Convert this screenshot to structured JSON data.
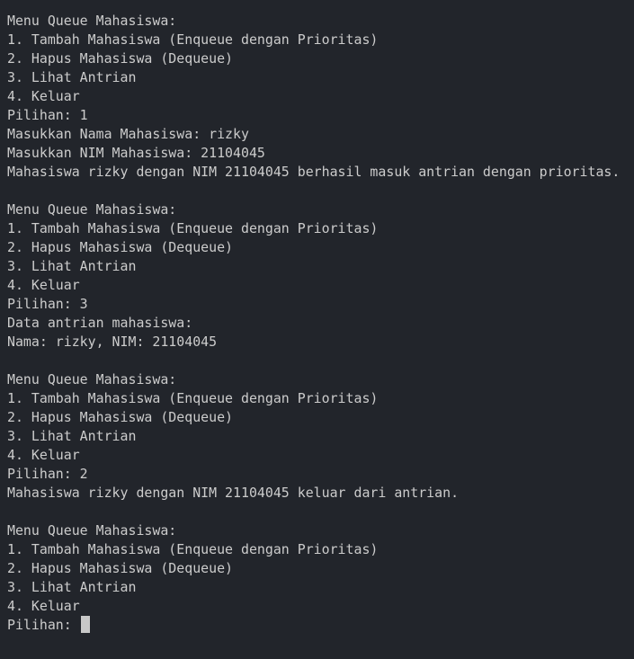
{
  "terminal": {
    "blocks": [
      {
        "menu_title": "Menu Queue Mahasiswa:",
        "options": [
          "1. Tambah Mahasiswa (Enqueue dengan Prioritas)",
          "2. Hapus Mahasiswa (Dequeue)",
          "3. Lihat Antrian",
          "4. Keluar"
        ],
        "choice": "Pilihan: 1",
        "output": [
          "Masukkan Nama Mahasiswa: rizky",
          "Masukkan NIM Mahasiswa: 21104045",
          "Mahasiswa rizky dengan NIM 21104045 berhasil masuk antrian dengan prioritas."
        ]
      },
      {
        "menu_title": "Menu Queue Mahasiswa:",
        "options": [
          "1. Tambah Mahasiswa (Enqueue dengan Prioritas)",
          "2. Hapus Mahasiswa (Dequeue)",
          "3. Lihat Antrian",
          "4. Keluar"
        ],
        "choice": "Pilihan: 3",
        "output": [
          "Data antrian mahasiswa:",
          "Nama: rizky, NIM: 21104045"
        ]
      },
      {
        "menu_title": "Menu Queue Mahasiswa:",
        "options": [
          "1. Tambah Mahasiswa (Enqueue dengan Prioritas)",
          "2. Hapus Mahasiswa (Dequeue)",
          "3. Lihat Antrian",
          "4. Keluar"
        ],
        "choice": "Pilihan: 2",
        "output": [
          "Mahasiswa rizky dengan NIM 21104045 keluar dari antrian."
        ]
      },
      {
        "menu_title": "Menu Queue Mahasiswa:",
        "options": [
          "1. Tambah Mahasiswa (Enqueue dengan Prioritas)",
          "2. Hapus Mahasiswa (Dequeue)",
          "3. Lihat Antrian",
          "4. Keluar"
        ]
      }
    ],
    "prompt": "Pilihan: ",
    "colors": {
      "background": "#22252b",
      "text": "#cccccc",
      "cursor": "#c8c8c8"
    }
  }
}
